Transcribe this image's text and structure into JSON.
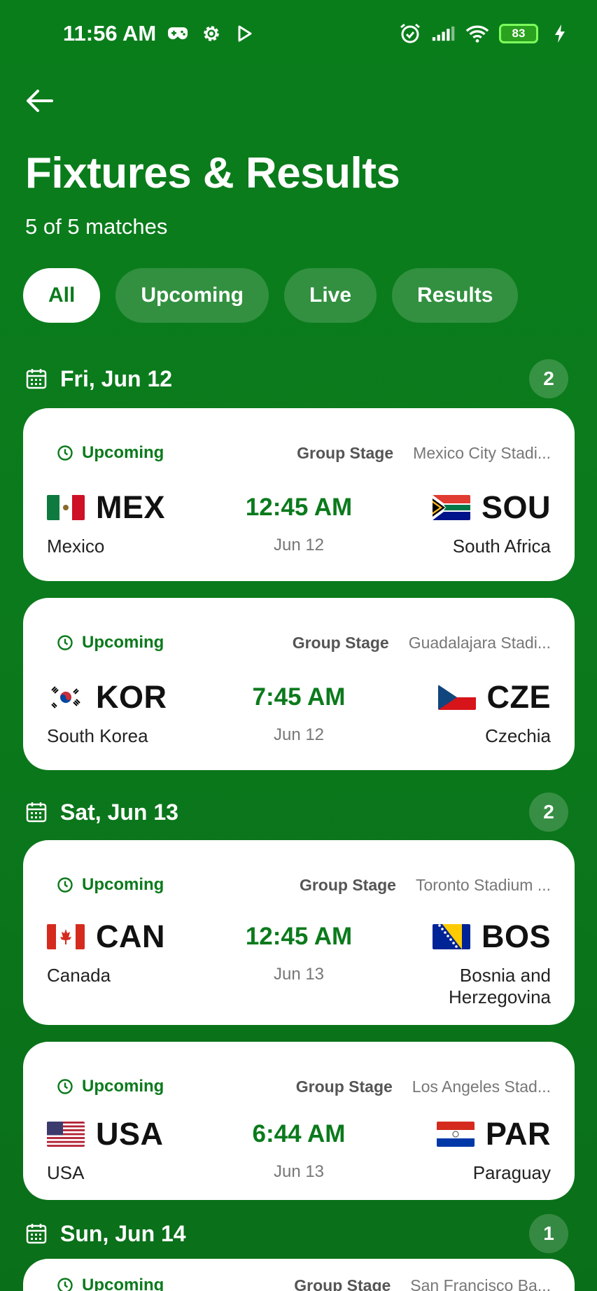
{
  "status_bar": {
    "time": "11:56 AM",
    "battery": "83"
  },
  "header": {
    "title": "Fixtures & Results",
    "subtitle": "5 of 5 matches"
  },
  "filters": [
    "All",
    "Upcoming",
    "Live",
    "Results"
  ],
  "active_filter": "All",
  "days": [
    {
      "label": "Fri, Jun 12",
      "count": "2"
    },
    {
      "label": "Sat, Jun 13",
      "count": "2"
    },
    {
      "label": "Sun, Jun 14",
      "count": "1"
    }
  ],
  "matches": [
    {
      "status": "Upcoming",
      "stage": "Group Stage",
      "venue": "Mexico City Stadi...",
      "home_code": "MEX",
      "home_name": "Mexico",
      "home_flag": "mexico-flag",
      "time": "12:45 AM",
      "date": "Jun 12",
      "away_code": "SOU",
      "away_name": "South Africa",
      "away_flag": "south-africa-flag"
    },
    {
      "status": "Upcoming",
      "stage": "Group Stage",
      "venue": "Guadalajara Stadi...",
      "home_code": "KOR",
      "home_name": "South Korea",
      "home_flag": "south-korea-flag",
      "time": "7:45 AM",
      "date": "Jun 12",
      "away_code": "CZE",
      "away_name": "Czechia",
      "away_flag": "czechia-flag"
    },
    {
      "status": "Upcoming",
      "stage": "Group Stage",
      "venue": "Toronto Stadium ...",
      "home_code": "CAN",
      "home_name": "Canada",
      "home_flag": "canada-flag",
      "time": "12:45 AM",
      "date": "Jun 13",
      "away_code": "BOS",
      "away_name_line1": "Bosnia and",
      "away_name_line2": "Herzegovina",
      "away_flag": "bosnia-flag"
    },
    {
      "status": "Upcoming",
      "stage": "Group Stage",
      "venue": "Los Angeles Stad...",
      "home_code": "USA",
      "home_name": "USA",
      "home_flag": "usa-flag",
      "time": "6:44 AM",
      "date": "Jun 13",
      "away_code": "PAR",
      "away_name": "Paraguay",
      "away_flag": "paraguay-flag"
    },
    {
      "status": "Upcoming",
      "stage": "Group Stage",
      "venue": "San Francisco Ba..."
    }
  ],
  "colors": {
    "accent": "#0b7a1c",
    "background": "#0a7d1b",
    "card": "#ffffff"
  }
}
